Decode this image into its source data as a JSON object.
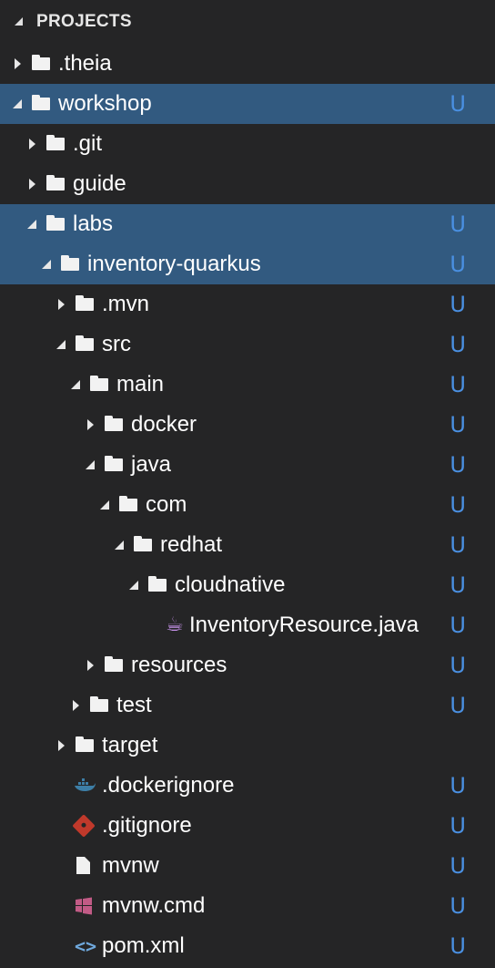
{
  "section": {
    "title": "PROJECTS"
  },
  "badge_color": "#4a90e2",
  "selection_color": "#325a80",
  "tree": [
    {
      "label": ".theia",
      "depth": 0,
      "kind": "folder",
      "expanded": false,
      "badge": "",
      "selected": false
    },
    {
      "label": "workshop",
      "depth": 0,
      "kind": "folder",
      "expanded": true,
      "badge": "U",
      "selected": true
    },
    {
      "label": ".git",
      "depth": 1,
      "kind": "folder",
      "expanded": false,
      "badge": "",
      "selected": false
    },
    {
      "label": "guide",
      "depth": 1,
      "kind": "folder",
      "expanded": false,
      "badge": "",
      "selected": false
    },
    {
      "label": "labs",
      "depth": 1,
      "kind": "folder",
      "expanded": true,
      "badge": "U",
      "selected": true
    },
    {
      "label": "inventory-quarkus",
      "depth": 2,
      "kind": "folder",
      "expanded": true,
      "badge": "U",
      "selected": true
    },
    {
      "label": ".mvn",
      "depth": 3,
      "kind": "folder",
      "expanded": false,
      "badge": "U",
      "selected": false
    },
    {
      "label": "src",
      "depth": 3,
      "kind": "folder",
      "expanded": true,
      "badge": "U",
      "selected": false
    },
    {
      "label": "main",
      "depth": 4,
      "kind": "folder",
      "expanded": true,
      "badge": "U",
      "selected": false
    },
    {
      "label": "docker",
      "depth": 5,
      "kind": "folder",
      "expanded": false,
      "badge": "U",
      "selected": false
    },
    {
      "label": "java",
      "depth": 5,
      "kind": "folder",
      "expanded": true,
      "badge": "U",
      "selected": false
    },
    {
      "label": "com",
      "depth": 6,
      "kind": "folder",
      "expanded": true,
      "badge": "U",
      "selected": false
    },
    {
      "label": "redhat",
      "depth": 7,
      "kind": "folder",
      "expanded": true,
      "badge": "U",
      "selected": false
    },
    {
      "label": "cloudnative",
      "depth": 8,
      "kind": "folder",
      "expanded": true,
      "badge": "U",
      "selected": false
    },
    {
      "label": "InventoryResource.java",
      "depth": 9,
      "kind": "java-file",
      "expanded": null,
      "badge": "U",
      "selected": false
    },
    {
      "label": "resources",
      "depth": 5,
      "kind": "folder",
      "expanded": false,
      "badge": "U",
      "selected": false
    },
    {
      "label": "test",
      "depth": 4,
      "kind": "folder",
      "expanded": false,
      "badge": "U",
      "selected": false
    },
    {
      "label": "target",
      "depth": 3,
      "kind": "folder",
      "expanded": false,
      "badge": "",
      "selected": false
    },
    {
      "label": ".dockerignore",
      "depth": 3,
      "kind": "docker-file",
      "expanded": null,
      "badge": "U",
      "selected": false
    },
    {
      "label": ".gitignore",
      "depth": 3,
      "kind": "git-file",
      "expanded": null,
      "badge": "U",
      "selected": false
    },
    {
      "label": "mvnw",
      "depth": 3,
      "kind": "plain-file",
      "expanded": null,
      "badge": "U",
      "selected": false
    },
    {
      "label": "mvnw.cmd",
      "depth": 3,
      "kind": "windows-file",
      "expanded": null,
      "badge": "U",
      "selected": false
    },
    {
      "label": "pom.xml",
      "depth": 3,
      "kind": "xml-file",
      "expanded": null,
      "badge": "U",
      "selected": false
    }
  ]
}
